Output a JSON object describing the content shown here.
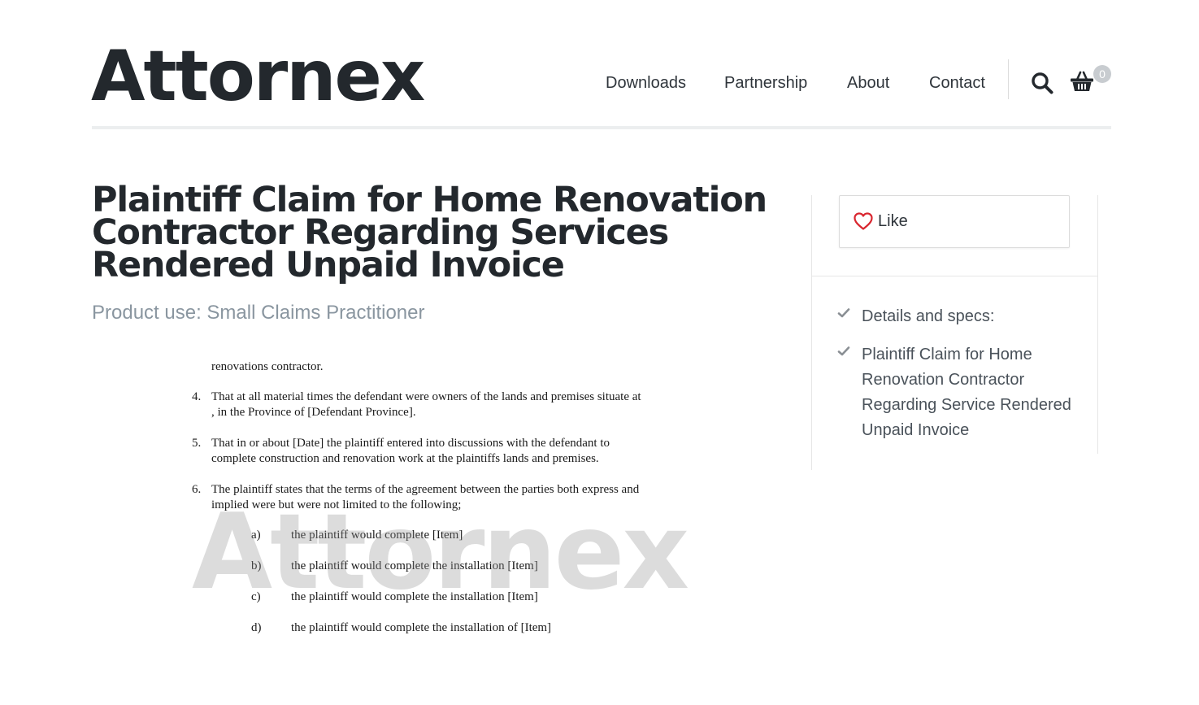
{
  "site": {
    "logo": "Attornex"
  },
  "nav": {
    "items": [
      "Downloads",
      "Partnership",
      "About",
      "Contact"
    ],
    "cart_count": "0"
  },
  "product": {
    "title": "Plaintiff Claim for Home Renovation Contractor Regarding Services Rendered Unpaid Invoice",
    "use": "Product use: Small Claims Practitioner"
  },
  "document_preview": {
    "lines": [
      "renovations contractor.",
      "4.",
      "That at all material times the defendant were owners of the lands and premises situate at",
      ", in the Province of [Defendant Province].",
      "5.",
      "That in or about [Date] the plaintiff entered into discussions with the defendant to",
      "complete construction and renovation work at the plaintiffs lands and premises.",
      "6.",
      "The plaintiff states that the terms of the agreement between the parties both express and",
      "implied were but were not limited to the following;",
      "a)",
      "the plaintiff  would complete [Item]",
      "b)",
      "the plaintiff would complete the installation [Item]",
      "c)",
      "the plaintiff would complete the installation [Item]",
      "d)",
      "the plaintiff would complete the installation of [Item]"
    ],
    "watermark": "Attornex"
  },
  "sidebar": {
    "like_label": "Like",
    "specs": [
      "Details and specs:",
      "Plaintiff Claim for Home Renovation Contractor Regarding Service Rendered Unpaid Invoice"
    ]
  },
  "colors": {
    "heart": "#d9262f",
    "accent_text": "#8a96a0",
    "check": "#8a8f94"
  }
}
